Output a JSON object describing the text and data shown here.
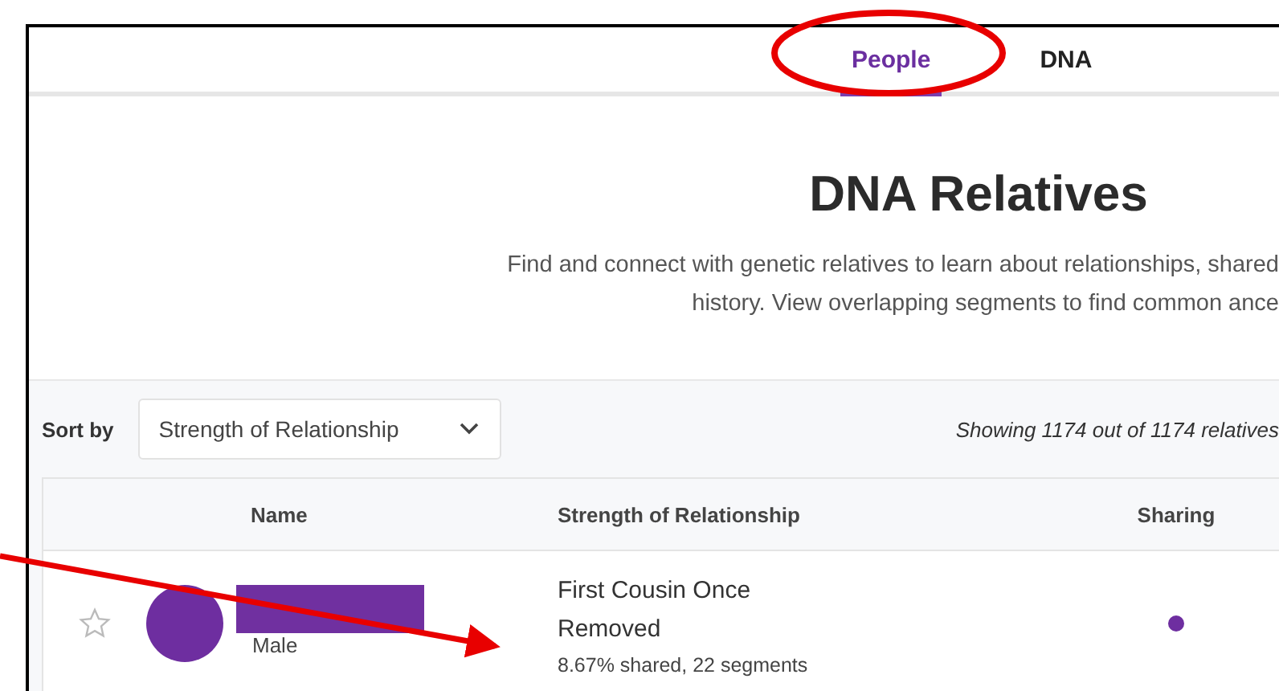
{
  "nav": {
    "tabs": [
      {
        "label": "People",
        "selected": true
      },
      {
        "label": "DNA",
        "selected": false
      }
    ]
  },
  "header": {
    "title": "DNA Relatives",
    "description_lines": [
      "Find and connect with genetic relatives to learn about relationships, shared",
      "history. View overlapping segments to find common ance"
    ]
  },
  "sort": {
    "label": "Sort by",
    "value": "Strength of Relationship"
  },
  "summary": "Showing 1174 out of 1174 relatives",
  "table": {
    "columns": [
      "Name",
      "Strength of Relationship",
      "Sharing"
    ],
    "rows": [
      {
        "starred": false,
        "sex": "Male",
        "relationship": "First Cousin Once Removed",
        "shared": "8.67% shared, 22 segments",
        "sharing": true
      }
    ]
  },
  "annotations": [
    {
      "kind": "ellipse"
    },
    {
      "kind": "arrow"
    }
  ]
}
